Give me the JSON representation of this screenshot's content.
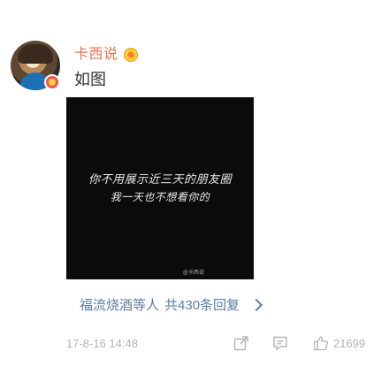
{
  "post": {
    "username": "卡西说",
    "vip_icon": "vip-badge-icon",
    "text": "如图",
    "image": {
      "line1": "你不用展示近三天的朋友圈",
      "line2": "我一天也不想看你的",
      "watermark": "@卡西说"
    }
  },
  "repost": {
    "names": "福流烧酒等人",
    "count": "共430条回复"
  },
  "footer": {
    "timestamp": "17-8-16 14:48",
    "share_icon": "share-icon",
    "comment_icon": "comment-icon",
    "like_icon": "thumbs-up-icon",
    "like_count": "21699"
  },
  "colors": {
    "username": "#eb7350",
    "link": "#5b7ea8",
    "muted": "#b3b3b3"
  }
}
